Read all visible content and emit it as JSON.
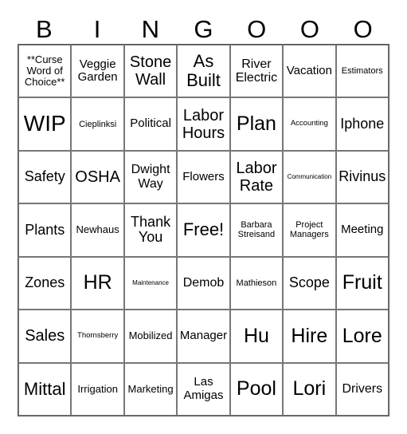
{
  "header": [
    "B",
    "I",
    "N",
    "G",
    "O",
    "O",
    "O"
  ],
  "cells": [
    [
      "**Curse Word of Choice**",
      "Veggie Garden",
      "Stone Wall",
      "As Built",
      "River Electric",
      "Vacation",
      "Estimators"
    ],
    [
      "WIP",
      "Cieplinksi",
      "Political",
      "Labor Hours",
      "Plan",
      "Accounting",
      "Iphone"
    ],
    [
      "Safety",
      "OSHA",
      "Dwight Way",
      "Flowers",
      "Labor Rate",
      "Communication",
      "Rivinus"
    ],
    [
      "Plants",
      "Newhaus",
      "Thank You",
      "Free!",
      "Barbara Streisand",
      "Project Managers",
      "Meeting"
    ],
    [
      "Zones",
      "HR",
      "Maintenance",
      "Demob",
      "Mathieson",
      "Scope",
      "Fruit"
    ],
    [
      "Sales",
      "Thornsberry",
      "Mobilized",
      "Manager",
      "Hu",
      "Hire",
      "Lore"
    ],
    [
      "Mittal",
      "Irrigation",
      "Marketing",
      "Las Amigas",
      "Pool",
      "Lori",
      "Drivers"
    ]
  ]
}
